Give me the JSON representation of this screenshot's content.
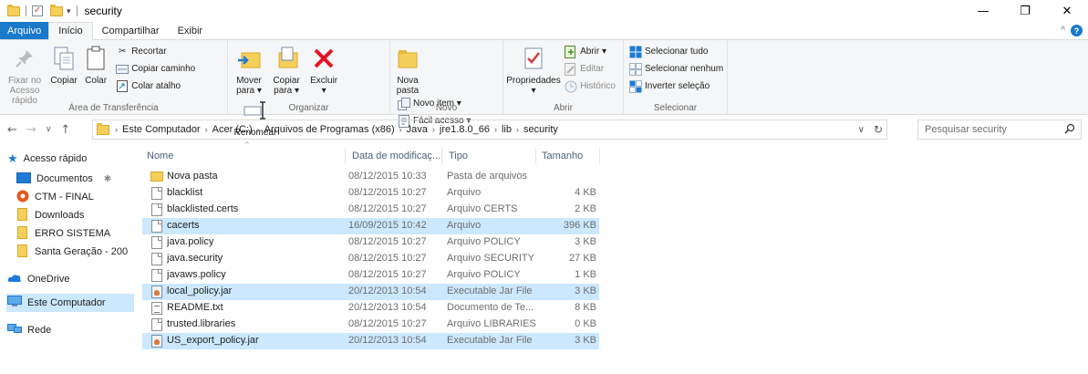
{
  "window": {
    "title": "security",
    "controls": {
      "minimize": "—",
      "maximize": "❐",
      "close": "✕"
    }
  },
  "tabs": [
    {
      "label": "Arquivo"
    },
    {
      "label": "Início"
    },
    {
      "label": "Compartilhar"
    },
    {
      "label": "Exibir"
    }
  ],
  "ribbon": {
    "clipboard": {
      "label": "Área de Transferência",
      "pin": "Fixar no\nAcesso rápido",
      "copy": "Copiar",
      "paste": "Colar",
      "cut": "Recortar",
      "copy_path": "Copiar caminho",
      "paste_shortcut": "Colar atalho"
    },
    "organize": {
      "label": "Organizar",
      "move_to": "Mover\npara ▾",
      "copy_to": "Copiar\npara ▾",
      "delete": "Excluir\n▾",
      "rename": "Renomear"
    },
    "new": {
      "label": "Novo",
      "new_folder": "Nova\npasta",
      "new_item": "Novo item ▾",
      "easy_access": "Fácil acesso ▾"
    },
    "open": {
      "label": "Abrir",
      "properties": "Propriedades\n▾",
      "open": "Abrir ▾",
      "edit": "Editar",
      "history": "Histórico"
    },
    "select": {
      "label": "Selecionar",
      "select_all": "Selecionar tudo",
      "select_none": "Selecionar nenhum",
      "invert": "Inverter seleção"
    }
  },
  "address": {
    "crumbs": [
      "Este Computador",
      "Acer (C:)",
      "Arquivos de Programas (x86)",
      "Java",
      "jre1.8.0_66",
      "lib",
      "security"
    ],
    "search_placeholder": "Pesquisar security"
  },
  "navpane": {
    "quick_access": "Acesso rápido",
    "items": [
      "Documentos",
      "CTM - FINAL",
      "Downloads",
      "ERRO SISTEMA",
      "Santa Geração - 200"
    ],
    "onedrive": "OneDrive",
    "this_pc": "Este Computador",
    "network": "Rede"
  },
  "columns": {
    "name": "Nome",
    "date": "Data de modificaç...",
    "type": "Tipo",
    "size": "Tamanho"
  },
  "files": [
    {
      "name": "Nova pasta",
      "date": "08/12/2015 10:33",
      "type": "Pasta de arquivos",
      "size": ""
    },
    {
      "name": "blacklist",
      "date": "08/12/2015 10:27",
      "type": "Arquivo",
      "size": "4 KB"
    },
    {
      "name": "blacklisted.certs",
      "date": "08/12/2015 10:27",
      "type": "Arquivo CERTS",
      "size": "2 KB"
    },
    {
      "name": "cacerts",
      "date": "16/09/2015 10:42",
      "type": "Arquivo",
      "size": "396 KB"
    },
    {
      "name": "java.policy",
      "date": "08/12/2015 10:27",
      "type": "Arquivo POLICY",
      "size": "3 KB"
    },
    {
      "name": "java.security",
      "date": "08/12/2015 10:27",
      "type": "Arquivo SECURITY",
      "size": "27 KB"
    },
    {
      "name": "javaws.policy",
      "date": "08/12/2015 10:27",
      "type": "Arquivo POLICY",
      "size": "1 KB"
    },
    {
      "name": "local_policy.jar",
      "date": "20/12/2013 10:54",
      "type": "Executable Jar File",
      "size": "3 KB"
    },
    {
      "name": "README.txt",
      "date": "20/12/2013 10:54",
      "type": "Documento de Te...",
      "size": "8 KB"
    },
    {
      "name": "trusted.libraries",
      "date": "08/12/2015 10:27",
      "type": "Arquivo LIBRARIES",
      "size": "0 KB"
    },
    {
      "name": "US_export_policy.jar",
      "date": "20/12/2013 10:54",
      "type": "Executable Jar File",
      "size": "3 KB"
    }
  ]
}
